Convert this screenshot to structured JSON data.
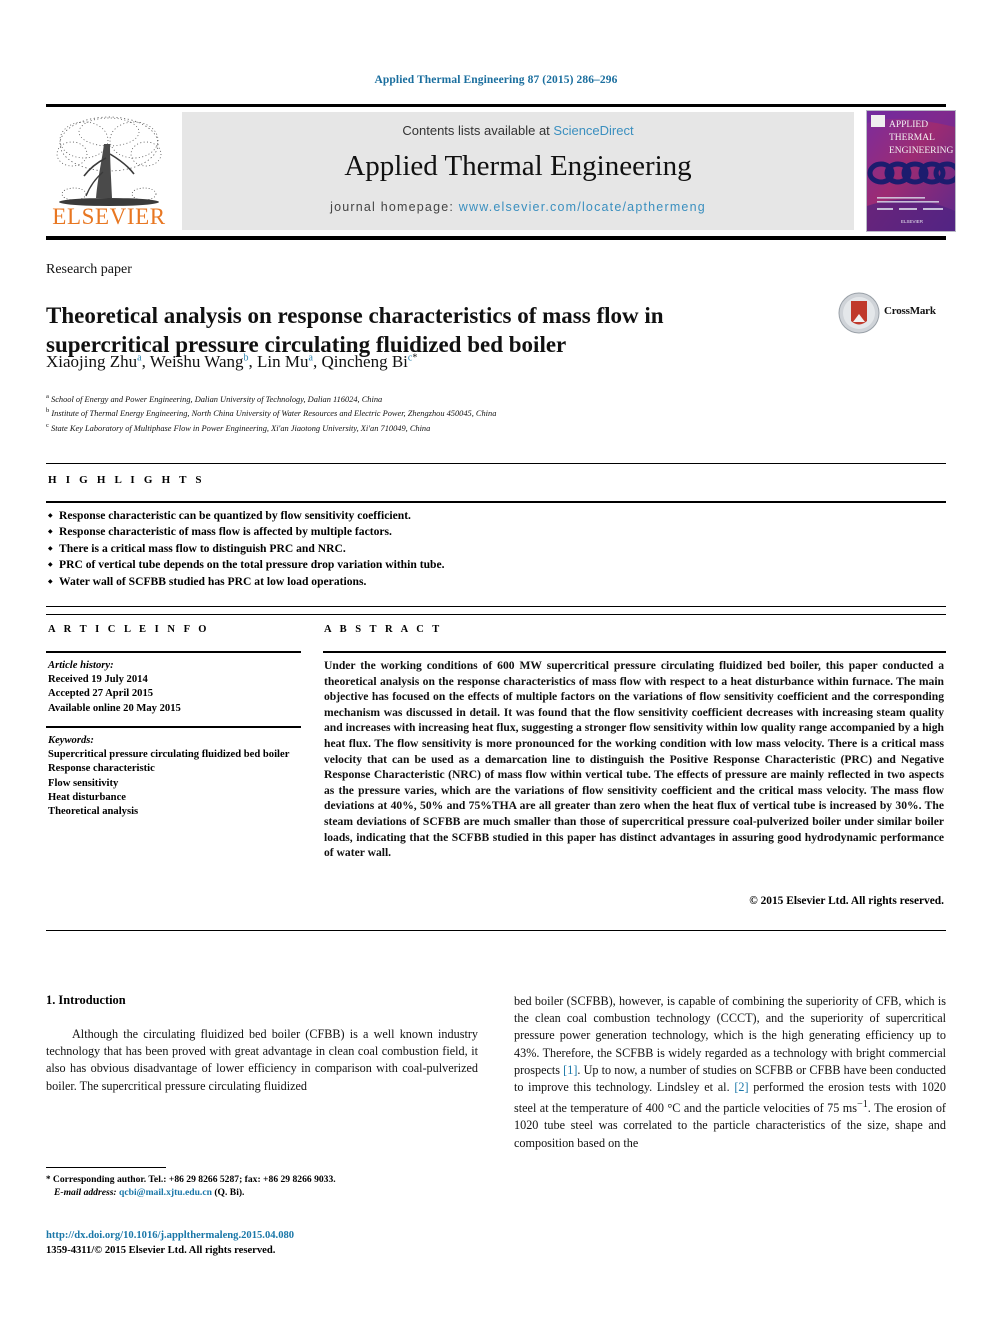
{
  "running_head": "Applied Thermal Engineering 87 (2015) 286–296",
  "masthead": {
    "contents_prefix": "Contents lists available at ",
    "contents_link": "ScienceDirect",
    "journal_title": "Applied Thermal Engineering",
    "homepage_prefix": "journal homepage: ",
    "homepage_url": "www.elsevier.com/locate/apthermeng",
    "publisher_logo_text": "ELSEVIER",
    "cover_title_lines": [
      "APPLIED",
      "THERMAL",
      "ENGINEERING"
    ],
    "accent_link_color": "#3a8fbf",
    "elsevier_orange": "#E87722"
  },
  "article": {
    "type": "Research paper",
    "title": "Theoretical analysis on response characteristics of mass flow in supercritical pressure circulating fluidized bed boiler",
    "crossmark_label": "CrossMark",
    "authors": [
      {
        "name": "Xiaojing Zhu",
        "marks": "a",
        "sep": ", "
      },
      {
        "name": "Weishu Wang",
        "marks": "b",
        "sep": ", "
      },
      {
        "name": "Lin Mu",
        "marks": "a",
        "sep": ", "
      },
      {
        "name": "Qincheng Bi",
        "marks": "c",
        "sep": "",
        "star": "*"
      }
    ],
    "affiliations": [
      {
        "mark": "a",
        "text": "School of Energy and Power Engineering, Dalian University of Technology, Dalian 116024, China"
      },
      {
        "mark": "b",
        "text": "Institute of Thermal Energy Engineering, North China University of Water Resources and Electric Power, Zhengzhou 450045, China"
      },
      {
        "mark": "c",
        "text": "State Key Laboratory of Multiphase Flow in Power Engineering, Xi'an Jiaotong University, Xi'an 710049, China"
      }
    ]
  },
  "highlights": {
    "heading": "H I G H L I G H T S",
    "items": [
      "Response characteristic can be quantized by flow sensitivity coefficient.",
      "Response characteristic of mass flow is affected by multiple factors.",
      "There is a critical mass flow to distinguish PRC and NRC.",
      "PRC of vertical tube depends on the total pressure drop variation within tube.",
      "Water wall of SCFBB studied has PRC at low load operations."
    ]
  },
  "article_info": {
    "heading": "A R T I C L E  I N F O",
    "history_label": "Article history:",
    "history": [
      "Received 19 July 2014",
      "Accepted 27 April 2015",
      "Available online 20 May 2015"
    ],
    "keywords_label": "Keywords:",
    "keywords": [
      "Supercritical pressure circulating fluidized bed boiler",
      "Response characteristic",
      "Flow sensitivity",
      "Heat disturbance",
      "Theoretical analysis"
    ]
  },
  "abstract": {
    "heading": "A B S T R A C T",
    "text": "Under the working conditions of 600 MW supercritical pressure circulating fluidized bed boiler, this paper conducted a theoretical analysis on the response characteristics of mass flow with respect to a heat disturbance within furnace. The main objective has focused on the effects of multiple factors on the variations of flow sensitivity coefficient and the corresponding mechanism was discussed in detail. It was found that the flow sensitivity coefficient decreases with increasing steam quality and increases with increasing heat flux, suggesting a stronger flow sensitivity within low quality range accompanied by a high heat flux. The flow sensitivity is more pronounced for the working condition with low mass velocity. There is a critical mass velocity that can be used as a demarcation line to distinguish the Positive Response Characteristic (PRC) and Negative Response Characteristic (NRC) of mass flow within vertical tube. The effects of pressure are mainly reflected in two aspects as the pressure varies, which are the variations of flow sensitivity coefficient and the critical mass velocity. The mass flow deviations at 40%, 50% and 75%THA are all greater than zero when the heat flux of vertical tube is increased by 30%. The steam deviations of SCFBB are much smaller than those of supercritical pressure coal-pulverized boiler under similar boiler loads, indicating that the SCFBB studied in this paper has distinct advantages in assuring good hydrodynamic performance of water wall.",
    "copyright": "© 2015 Elsevier Ltd. All rights reserved."
  },
  "body": {
    "section_number_title": "1. Introduction",
    "left_paragraph": "Although the circulating fluidized bed boiler (CFBB) is a well known industry technology that has been proved with great advantage in clean coal combustion field, it also has obvious disadvantage of lower efficiency in comparison with coal-pulverized boiler. The supercritical pressure circulating fluidized",
    "right_part_1": "bed boiler (SCFBB), however, is capable of combining the superiority of CFB, which is the clean coal combustion technology (CCCT), and the superiority of supercritical pressure power generation technology, which is the high generating efficiency up to 43%. Therefore, the SCFBB is widely regarded as a technology with bright commercial prospects ",
    "ref_1": "[1]",
    "right_part_2": ". Up to now, a number of studies on SCFBB or CFBB have been conducted to improve this technology. Lindsley et al. ",
    "ref_2": "[2]",
    "right_part_3": " performed the erosion tests with 1020 steel at the temperature of 400 °C and the particle velocities of 75 ms",
    "right_sup": "−1",
    "right_part_4": ". The erosion of 1020 tube steel was correlated to the particle characteristics of the size, shape and composition based on the"
  },
  "footnote": {
    "star": "*",
    "corresponding": " Corresponding author. Tel.: +86 29 8266 5287; fax: +86 29 8266 9033.",
    "email_label": "E-mail address:",
    "email": "qcbi@mail.xjtu.edu.cn",
    "email_owner": "(Q. Bi).",
    "doi": "http://dx.doi.org/10.1016/j.applthermaleng.2015.04.080",
    "issn_line": "1359-4311/© 2015 Elsevier Ltd. All rights reserved."
  }
}
